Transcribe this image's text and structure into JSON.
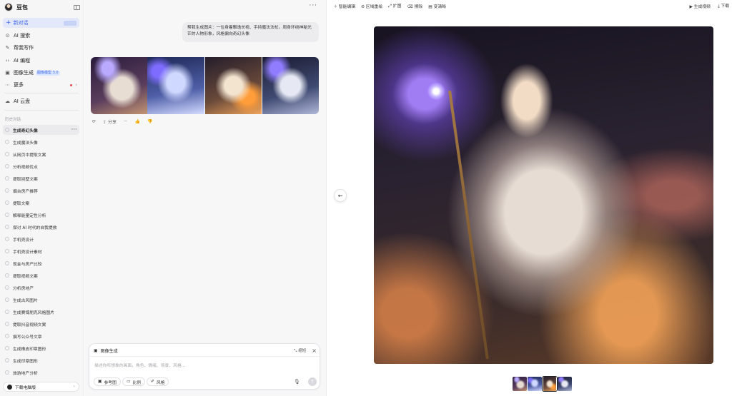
{
  "sidebar": {
    "brand": "豆包",
    "new_chat": "新对话",
    "nav": [
      {
        "label": "AI 搜索",
        "icon": "search-icon",
        "glyph": "⊙"
      },
      {
        "label": "帮我写作",
        "icon": "pen-icon",
        "glyph": "✎"
      },
      {
        "label": "AI 编程",
        "icon": "code-icon",
        "glyph": "‹›"
      },
      {
        "label": "图像生成",
        "icon": "image-icon",
        "glyph": "▣",
        "badge": "图像模型 3.0"
      },
      {
        "label": "更多",
        "icon": "grid-icon",
        "glyph": "⋯"
      },
      {
        "label": "AI 云盘",
        "icon": "cloud-icon",
        "glyph": "☁"
      }
    ],
    "history_title": "历史对话",
    "history": [
      "生成奇幻头像",
      "生成魔法头像",
      "从网页中提取文案",
      "分析视频优点",
      "提取别墅文案",
      "烟台房产推荐",
      "提取文案",
      "解释能量定性分析",
      "探讨 AI 时代的自我提救",
      "手机壳设计",
      "手机壳设计素材",
      "现金与房产比较",
      "提取视频文案",
      "分析房地产",
      "生成古风图片",
      "生成赛博朋克风格图片",
      "提取抖音视频文案",
      "撰写公众号文章",
      "生成橡皮印章图形",
      "生成印章图形",
      "旅游地产分析"
    ],
    "download": "下载电脑版"
  },
  "chat": {
    "user_message": "帮我生成图片：一位身着飘逸长袍、手持魔法法杖，周身环绕神秘光芒的人物形象，风格偏向奇幻头像",
    "actions": {
      "share": "分享"
    },
    "composer": {
      "mode": "图像生成",
      "expand": "缩短",
      "placeholder": "描述你所想象的画面，角色、情绪、场景、风格…",
      "chips": [
        {
          "label": "参考图",
          "icon": "image-icon",
          "glyph": "▣"
        },
        {
          "label": "比例",
          "icon": "ratio-icon",
          "glyph": "▭"
        },
        {
          "label": "风格",
          "icon": "brush-icon",
          "glyph": "✐"
        }
      ]
    }
  },
  "preview": {
    "tools": [
      {
        "label": "智能编辑",
        "icon": "magic-icon",
        "glyph": "✧"
      },
      {
        "label": "区域重绘",
        "icon": "brush-icon",
        "glyph": "⊘"
      },
      {
        "label": "扩图",
        "icon": "expand-icon",
        "glyph": "⤢"
      },
      {
        "label": "擦除",
        "icon": "eraser-icon",
        "glyph": "⌫"
      },
      {
        "label": "变清晰",
        "icon": "hd-icon",
        "glyph": "▤"
      }
    ],
    "right": [
      {
        "label": "生成视频",
        "icon": "video-icon",
        "glyph": "▶"
      },
      {
        "label": "下载",
        "icon": "download-icon",
        "glyph": "⤓"
      }
    ]
  }
}
